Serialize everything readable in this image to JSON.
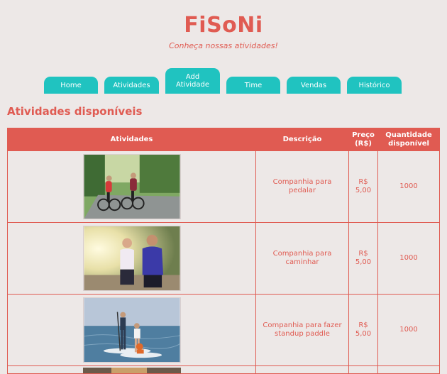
{
  "site": {
    "title": "FiSoNi",
    "subtitle": "Conheça nossas atividades!"
  },
  "nav": {
    "tabs": [
      {
        "label": "Home"
      },
      {
        "label": "Atividades"
      },
      {
        "label": "Add Atividade"
      },
      {
        "label": "Time"
      },
      {
        "label": "Vendas"
      },
      {
        "label": "Histórico"
      }
    ],
    "active_tab": "Add Atividade"
  },
  "section": {
    "title": "Atividades disponíveis"
  },
  "table": {
    "headers": [
      "Atividades",
      "Descrição",
      "Preço (R$)",
      "Quantidade disponível"
    ],
    "rows": [
      {
        "image": "cycling-photo",
        "description": "Companhia para pedalar",
        "price": "R$ 5,00",
        "quantity": "1000"
      },
      {
        "image": "running-couple-photo",
        "description": "Companhia para caminhar",
        "price": "R$ 5,00",
        "quantity": "1000"
      },
      {
        "image": "standup-paddle-photo",
        "description": "Companhia para fazer standup paddle",
        "price": "R$ 5,00",
        "quantity": "1000"
      }
    ]
  },
  "colors": {
    "accent": "#e05b52",
    "tab": "#20c3c0",
    "background": "#ede8e7"
  }
}
